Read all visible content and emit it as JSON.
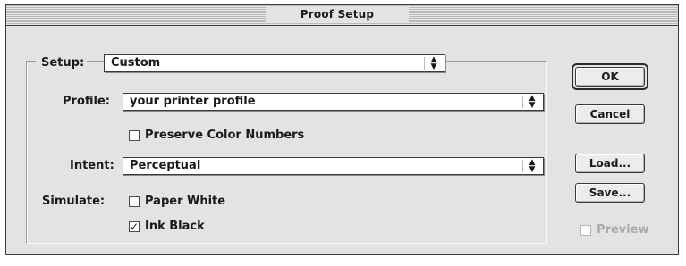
{
  "window": {
    "title": "Proof Setup"
  },
  "setup": {
    "label": "Setup:",
    "value": "Custom"
  },
  "profile": {
    "label": "Profile:",
    "value": "your printer profile"
  },
  "preserve": {
    "label": "Preserve Color Numbers",
    "checked": false
  },
  "intent": {
    "label": "Intent:",
    "value": "Perceptual"
  },
  "simulate": {
    "label": "Simulate:",
    "paper_white": {
      "label": "Paper White",
      "checked": false
    },
    "ink_black": {
      "label": "Ink Black",
      "checked": true
    }
  },
  "buttons": {
    "ok": "OK",
    "cancel": "Cancel",
    "load": "Load...",
    "save": "Save..."
  },
  "preview": {
    "label": "Preview",
    "checked": false,
    "enabled": false
  },
  "icons": {
    "popup_arrows": "up-down-arrows-icon",
    "checkmark": "checkmark-icon"
  }
}
